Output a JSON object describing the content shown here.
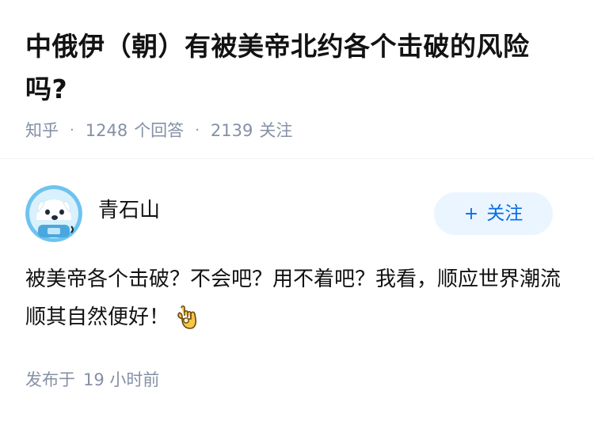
{
  "question": {
    "title": "中俄伊（朝）有被美帝北约各个击破的风险吗?",
    "meta": {
      "source": "知乎",
      "answer_count": "1248",
      "answer_label": "个回答",
      "follower_count": "2139",
      "follower_label": "关注"
    }
  },
  "answer": {
    "author": {
      "name": "青石山",
      "avatar_icon": "astronaut-dog-avatar"
    },
    "follow_button": {
      "plus": "+",
      "label": "关注"
    },
    "content": "被美帝各个击破？不会吧？用不着吧？我看，顺应世界潮流顺其自然便好！",
    "emoji_icon": "ok-hand-emoji-icon",
    "published": {
      "label": "发布于",
      "time": "19 小时前"
    }
  },
  "colors": {
    "accent": "#056de8",
    "accent_bg": "#ebf5ff",
    "meta_gray": "#8590a6",
    "text": "#121212"
  }
}
